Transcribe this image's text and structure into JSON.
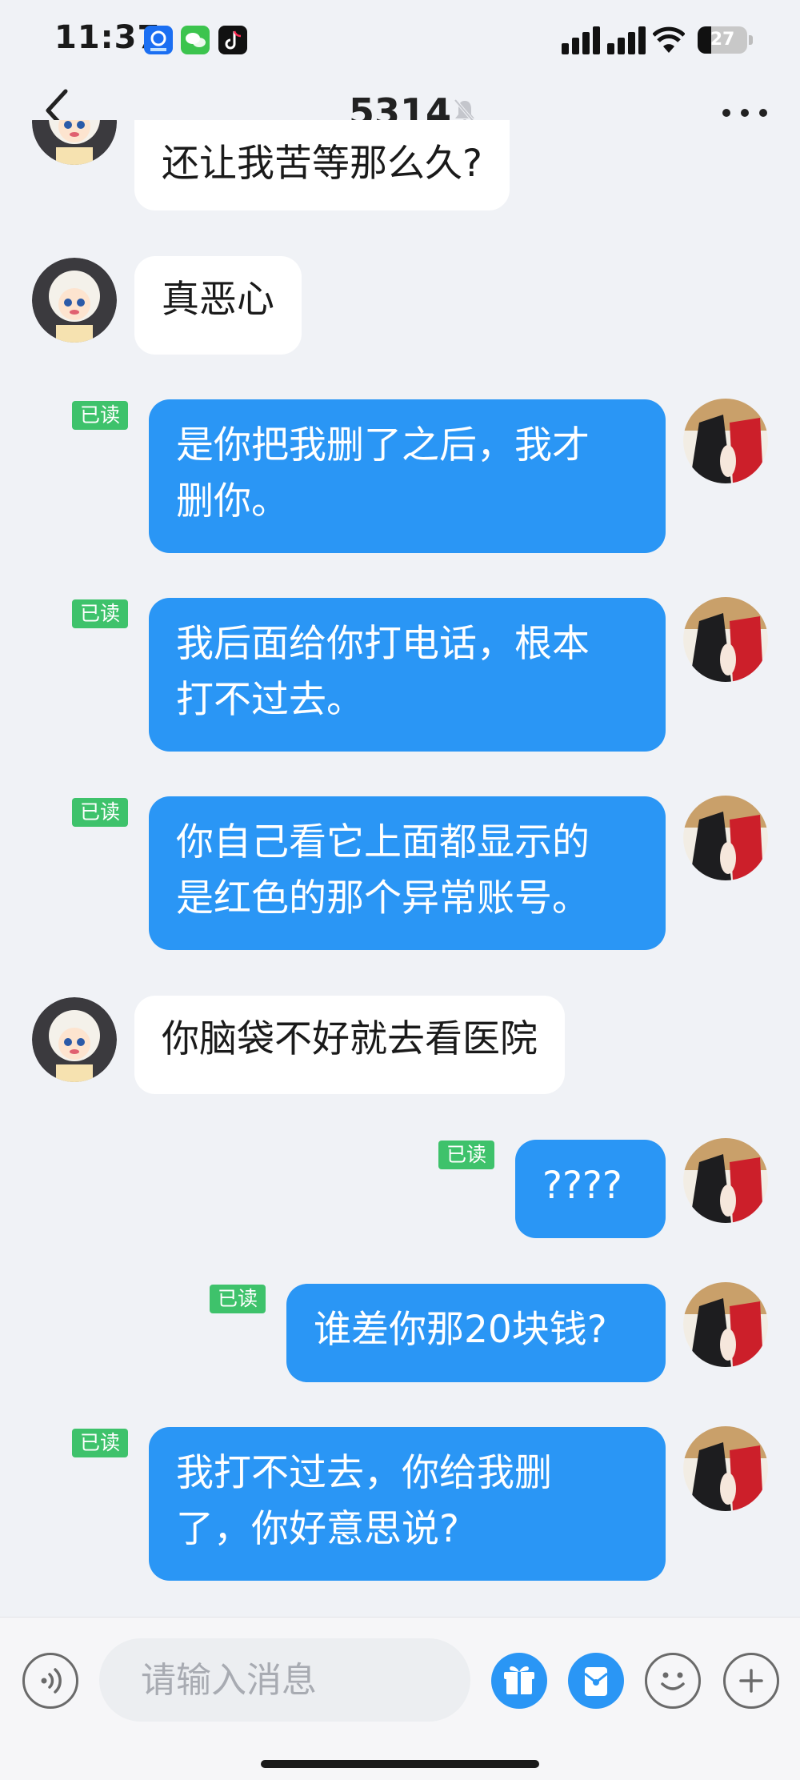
{
  "status_bar": {
    "time": "11:37",
    "battery": "27",
    "battery_level": 0.27
  },
  "header": {
    "title": "5314"
  },
  "read_label": "已读",
  "messages": [
    {
      "side": "in",
      "text": "还让我苦等那么久?"
    },
    {
      "side": "in",
      "text": "真恶心"
    },
    {
      "side": "out",
      "lines": [
        "是你把我删了之后，我才",
        "删你。"
      ],
      "read": true
    },
    {
      "side": "out",
      "lines": [
        "我后面给你打电话，根本",
        "打不过去。"
      ],
      "read": true
    },
    {
      "side": "out",
      "lines": [
        "你自己看它上面都显示的",
        "是红色的那个异常账号。"
      ],
      "read": true
    },
    {
      "side": "in",
      "text": "你脑袋不好就去看医院"
    },
    {
      "side": "out",
      "text": "????",
      "read": true
    },
    {
      "side": "out",
      "text": "谁差你那20块钱?",
      "read": true
    },
    {
      "side": "out",
      "lines": [
        "我打不过去，你给我删",
        "了，你好意思说?"
      ],
      "read": true
    }
  ],
  "input": {
    "placeholder": "请输入消息"
  },
  "colors": {
    "accent": "#2a96f5",
    "read_badge": "#3ec26b",
    "background": "#f0f2f6"
  },
  "icons": [
    "back-arrow-icon",
    "mute-bell-icon",
    "more-icon",
    "voice-icon",
    "gift-icon",
    "red-packet-icon",
    "emoji-icon",
    "plus-icon"
  ]
}
